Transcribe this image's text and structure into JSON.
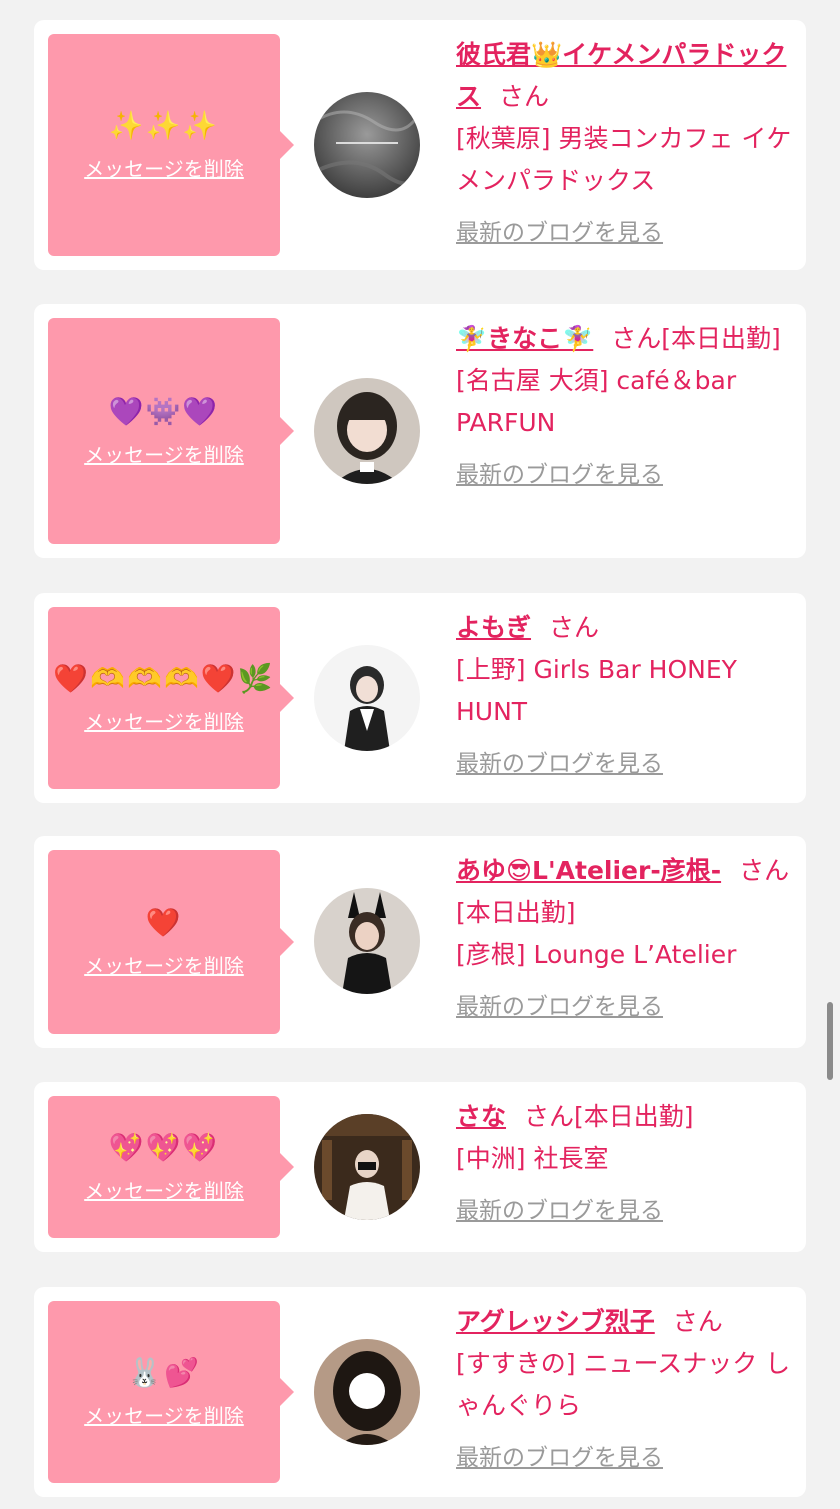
{
  "delete_label": "メッセージを削除",
  "blog_label": "最新のブログを見る",
  "accent_color": "#e3235f",
  "bubble_color": "#fe99ac",
  "cards": [
    {
      "emoji": "✨✨✨",
      "name": "彼氏君👑イケメンパラドックス",
      "honor": "さん",
      "status": "",
      "shop": "[秋葉原] 男装コンカフェ イケメンパラドックス"
    },
    {
      "emoji": "💜👾💜",
      "name": "🧚‍♀️きなこ🧚‍♀️",
      "honor": "さん",
      "status": "[本日出勤]",
      "shop": "[名古屋 大須] café＆bar PARFUN"
    },
    {
      "emoji": "❤️🫶🫶🫶❤️🌿",
      "name": "よもぎ",
      "honor": "さん",
      "status": "",
      "shop": "[上野] Girls Bar HONEY HUNT"
    },
    {
      "emoji": "❤️",
      "name": "あゆ😎L'Atelier-彦根-",
      "honor": "さん",
      "status": "[本日出勤]",
      "shop": "[彦根] Lounge L’Atelier"
    },
    {
      "emoji": "💖💖💖",
      "name": "さな",
      "honor": "さん",
      "status": "[本日出勤]",
      "shop": "[中洲] 社長室"
    },
    {
      "emoji": "🐰💕",
      "name": "アグレッシブ烈子",
      "honor": "さん",
      "status": "",
      "shop": "[すすきの] ニュースナック しゃんぐりら"
    }
  ]
}
